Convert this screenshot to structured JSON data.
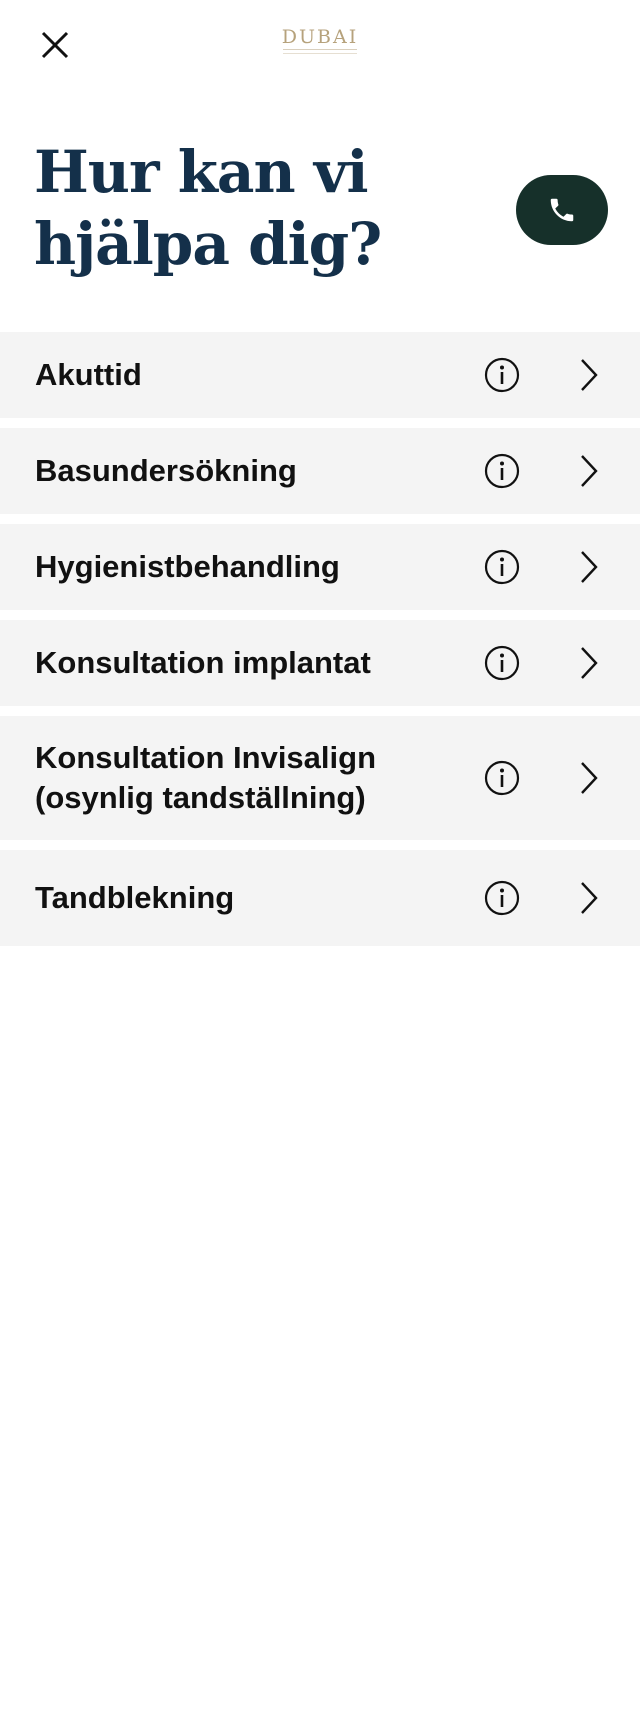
{
  "header": {
    "logo_text": "DUBAI",
    "close_icon": "close-icon",
    "logo_color": "#b6a27c"
  },
  "hero": {
    "title_line1": "Hur kan vi",
    "title_line2": "hjälpa dig?",
    "title_color": "#14304a",
    "call_icon": "phone-icon",
    "call_button_color": "#16302a"
  },
  "services": [
    {
      "label": "Akuttid"
    },
    {
      "label": "Basundersökning"
    },
    {
      "label": "Hygienistbehandling"
    },
    {
      "label": "Konsultation implantat"
    },
    {
      "label": "Konsultation Invisalign (osynlig tandställning)"
    },
    {
      "label": "Tandblekning"
    }
  ],
  "row_icons": {
    "info": "info-icon",
    "next": "chevron-right-icon"
  },
  "colors": {
    "row_background": "#f4f4f4",
    "text": "#111111"
  }
}
